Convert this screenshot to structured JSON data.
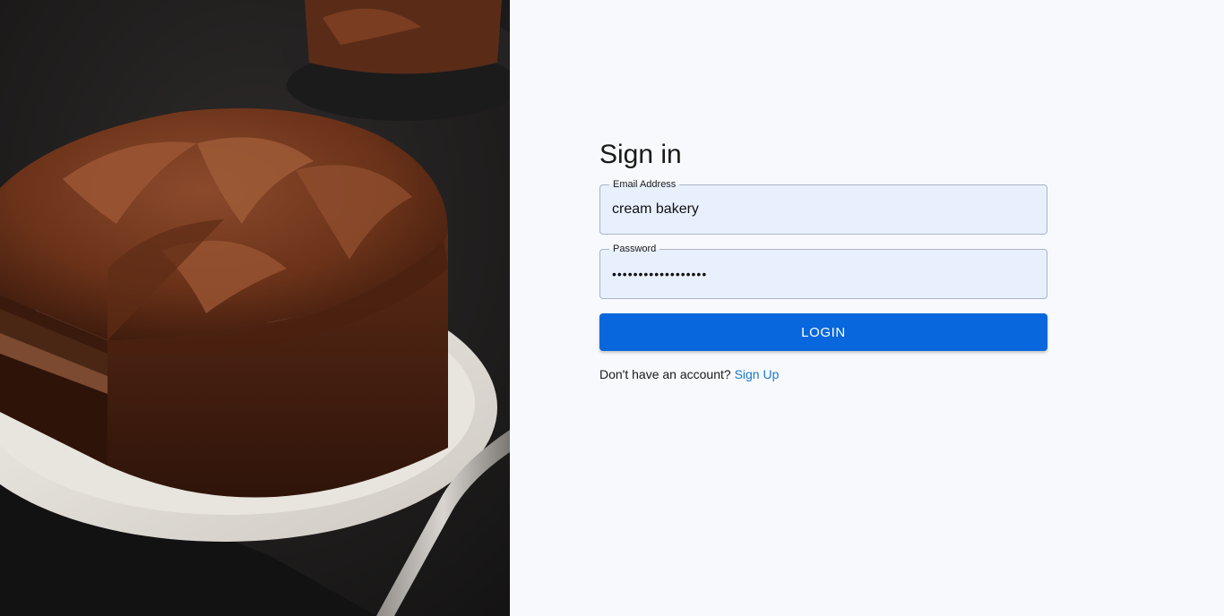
{
  "hero": {
    "image_icon": "chocolate-cake-photo"
  },
  "signin": {
    "title": "Sign in",
    "email": {
      "label": "Email Address",
      "value": "cream bakery"
    },
    "password": {
      "label": "Password",
      "value": "••••••••••••••••••"
    },
    "login_label": "LOGIN",
    "signup_prompt": "Don't have an account?",
    "signup_link": "Sign Up"
  },
  "colors": {
    "accent": "#0967dd",
    "link": "#1976d2",
    "field_bg": "#e8f0fe",
    "panel_bg": "#f8f9fc"
  }
}
